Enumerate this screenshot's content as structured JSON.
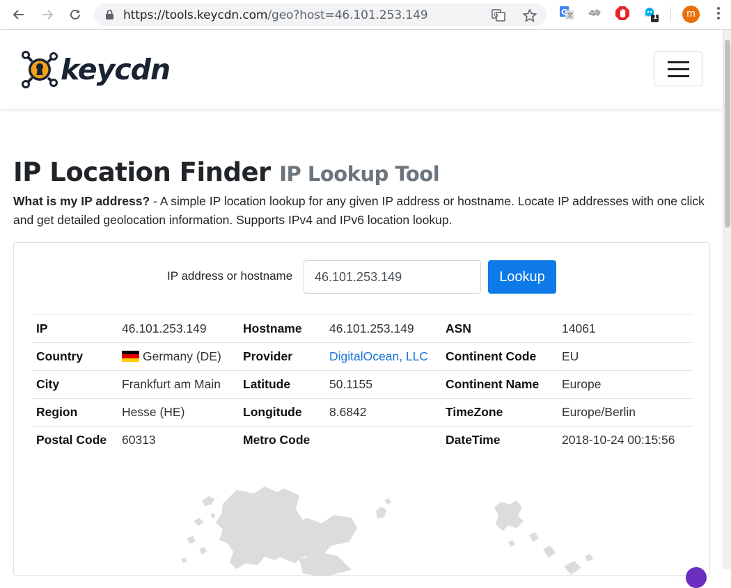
{
  "browser": {
    "url_host": "https://tools.keycdn.com",
    "url_path": "/geo?host=46.101.253.149",
    "extension_badge": "1",
    "profile_initial": "m"
  },
  "header": {
    "logo_text": "keycdn"
  },
  "page": {
    "title": "IP Location Finder",
    "subtitle": "IP Lookup Tool",
    "lead_bold": "What is my IP address?",
    "lead_text": " - A simple IP location lookup for any given IP address or hostname. Locate IP addresses with one click and get detailed geolocation information. Supports IPv4 and IPv6 location lookup."
  },
  "form": {
    "label": "IP address or hostname",
    "value": "46.101.253.149",
    "button": "Lookup"
  },
  "results": [
    [
      {
        "k": "IP",
        "v": "46.101.253.149"
      },
      {
        "k": "Hostname",
        "v": "46.101.253.149"
      },
      {
        "k": "ASN",
        "v": "14061"
      }
    ],
    [
      {
        "k": "Country",
        "v": "Germany (DE)"
      },
      {
        "k": "Provider",
        "v": "DigitalOcean, LLC"
      },
      {
        "k": "Continent Code",
        "v": "EU"
      }
    ],
    [
      {
        "k": "City",
        "v": "Frankfurt am Main"
      },
      {
        "k": "Latitude",
        "v": "50.1155"
      },
      {
        "k": "Continent Name",
        "v": "Europe"
      }
    ],
    [
      {
        "k": "Region",
        "v": "Hesse (HE)"
      },
      {
        "k": "Longitude",
        "v": "8.6842"
      },
      {
        "k": "TimeZone",
        "v": "Europe/Berlin"
      }
    ],
    [
      {
        "k": "Postal Code",
        "v": "60313"
      },
      {
        "k": "Metro Code",
        "v": ""
      },
      {
        "k": "DateTime",
        "v": "2018-10-24 00:15:56"
      }
    ]
  ],
  "colors": {
    "accent": "#0d7ae8",
    "logo_orange": "#f2a01c",
    "link": "#1a73d5"
  }
}
